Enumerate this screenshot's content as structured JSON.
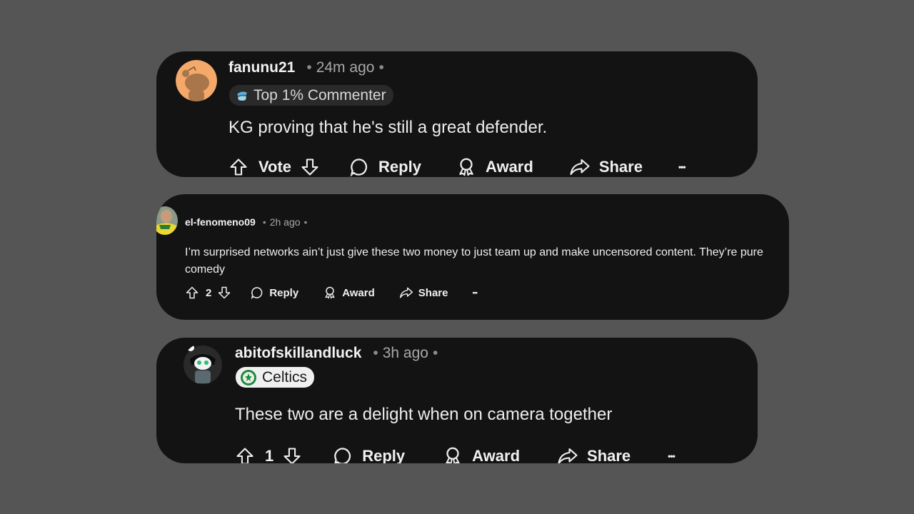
{
  "background_color": "#555555",
  "card_color": "#131313",
  "comments": [
    {
      "username": "fanunu21",
      "sep_1": "•",
      "time": "24m ago",
      "sep_2": "•",
      "avatar": "snoo-avatar-orange",
      "flair": {
        "icon": "top-commenter-icon",
        "label": "Top 1% Commenter"
      },
      "body": "KG proving that he's still a great defender.",
      "actions": {
        "vote": "Vote",
        "reply": "Reply",
        "award": "Award",
        "share": "Share",
        "more": "•••"
      }
    },
    {
      "username": "el-fenomeno09",
      "sep_1": "•",
      "time": "2h ago",
      "sep_2": "•",
      "avatar": "user-photo-avatar",
      "body": "I’m surprised networks ain’t just give these two money to just team up and make uncensored content. They’re pure comedy",
      "actions": {
        "vote": "2",
        "reply": "Reply",
        "award": "Award",
        "share": "Share",
        "more": "•••"
      }
    },
    {
      "username": "abitofskillandluck",
      "sep_1": "•",
      "time": "3h ago",
      "sep_2": "•",
      "avatar": "snoo-avatar-dark",
      "flair": {
        "icon": "celtics-logo-icon",
        "label": "Celtics"
      },
      "body": "These two are a delight when on camera together",
      "actions": {
        "vote": "1",
        "reply": "Reply",
        "award": "Award",
        "share": "Share",
        "more": "•••"
      }
    }
  ]
}
